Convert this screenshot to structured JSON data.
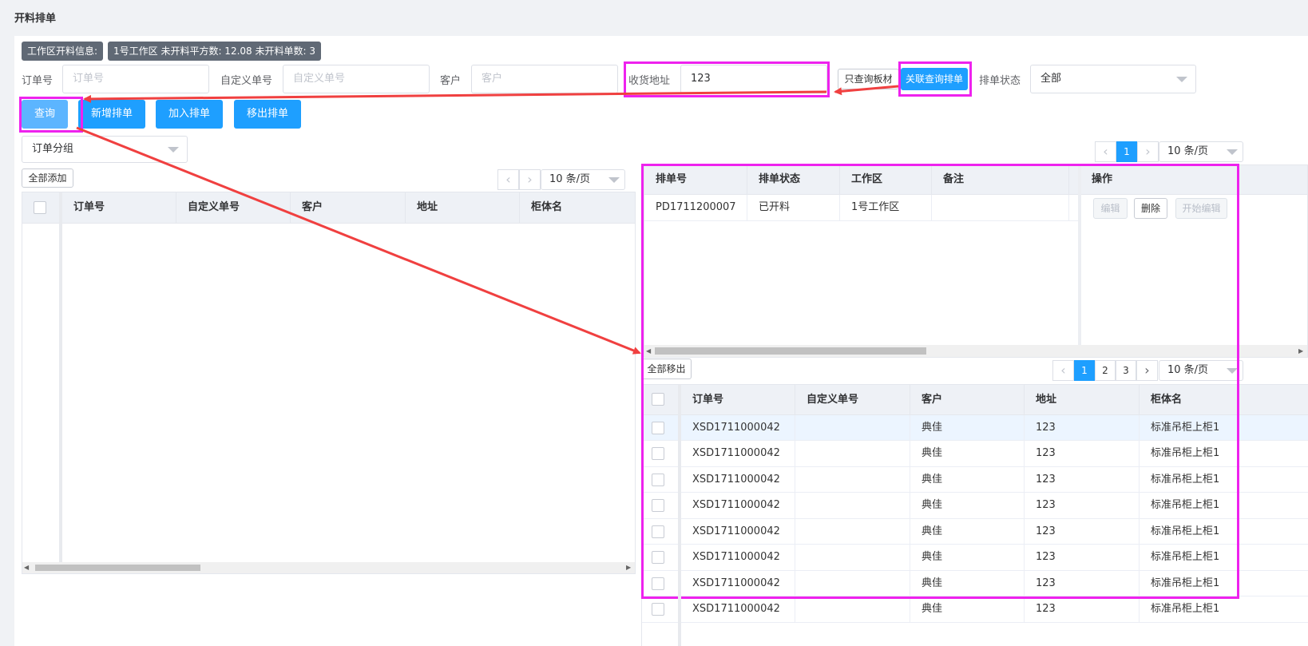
{
  "page_title": "开料排单",
  "info": {
    "label": "工作区开料信息:",
    "summary": "1号工作区 未开料平方数: 12.08 未开料单数: 3"
  },
  "filters": {
    "order_no": {
      "label": "订单号",
      "placeholder": "订单号",
      "value": ""
    },
    "custom_no": {
      "label": "自定义单号",
      "placeholder": "自定义单号",
      "value": ""
    },
    "customer": {
      "label": "客户",
      "placeholder": "客户",
      "value": ""
    },
    "address": {
      "label": "收货地址",
      "value": "123"
    },
    "only_board_btn": "只查询板材",
    "linked_query_btn": "关联查询排单",
    "status": {
      "label": "排单状态",
      "value": "全部"
    }
  },
  "toolbar": {
    "query": "查询",
    "new_schedule": "新增排单",
    "add_to_schedule": "加入排单",
    "remove_from_schedule": "移出排单"
  },
  "group_select": "订单分组",
  "left_table": {
    "add_all": "全部添加",
    "page_size": "10 条/页",
    "columns": [
      "订单号",
      "自定义单号",
      "客户",
      "地址",
      "柜体名"
    ],
    "rows": []
  },
  "schedule_table": {
    "page": "1",
    "page_size": "10 条/页",
    "columns": [
      "排单号",
      "排单状态",
      "工作区",
      "备注",
      "操作"
    ],
    "rows": [
      {
        "no": "PD1711200007",
        "status": "已开料",
        "workspace": "1号工作区",
        "remark": ""
      }
    ],
    "actions": {
      "edit": "编辑",
      "delete": "删除",
      "start_edit": "开始编辑"
    }
  },
  "detail_table": {
    "remove_all": "全部移出",
    "pages": [
      "1",
      "2",
      "3"
    ],
    "active_page": "1",
    "page_size": "10 条/页",
    "columns": [
      "订单号",
      "自定义单号",
      "客户",
      "地址",
      "柜体名"
    ],
    "rows": [
      {
        "order": "XSD1711000042",
        "custom": "",
        "customer": "典佳",
        "address": "123",
        "cabinet": "标准吊柜上柜1"
      },
      {
        "order": "XSD1711000042",
        "custom": "",
        "customer": "典佳",
        "address": "123",
        "cabinet": "标准吊柜上柜1"
      },
      {
        "order": "XSD1711000042",
        "custom": "",
        "customer": "典佳",
        "address": "123",
        "cabinet": "标准吊柜上柜1"
      },
      {
        "order": "XSD1711000042",
        "custom": "",
        "customer": "典佳",
        "address": "123",
        "cabinet": "标准吊柜上柜1"
      },
      {
        "order": "XSD1711000042",
        "custom": "",
        "customer": "典佳",
        "address": "123",
        "cabinet": "标准吊柜上柜1"
      },
      {
        "order": "XSD1711000042",
        "custom": "",
        "customer": "典佳",
        "address": "123",
        "cabinet": "标准吊柜上柜1"
      },
      {
        "order": "XSD1711000042",
        "custom": "",
        "customer": "典佳",
        "address": "123",
        "cabinet": "标准吊柜上柜1"
      },
      {
        "order": "XSD1711000042",
        "custom": "",
        "customer": "典佳",
        "address": "123",
        "cabinet": "标准吊柜上柜1"
      }
    ]
  },
  "colors": {
    "primary": "#1e9fff",
    "highlight": "#ee22ee",
    "arrow": "#f04040",
    "tag": "#606975"
  }
}
